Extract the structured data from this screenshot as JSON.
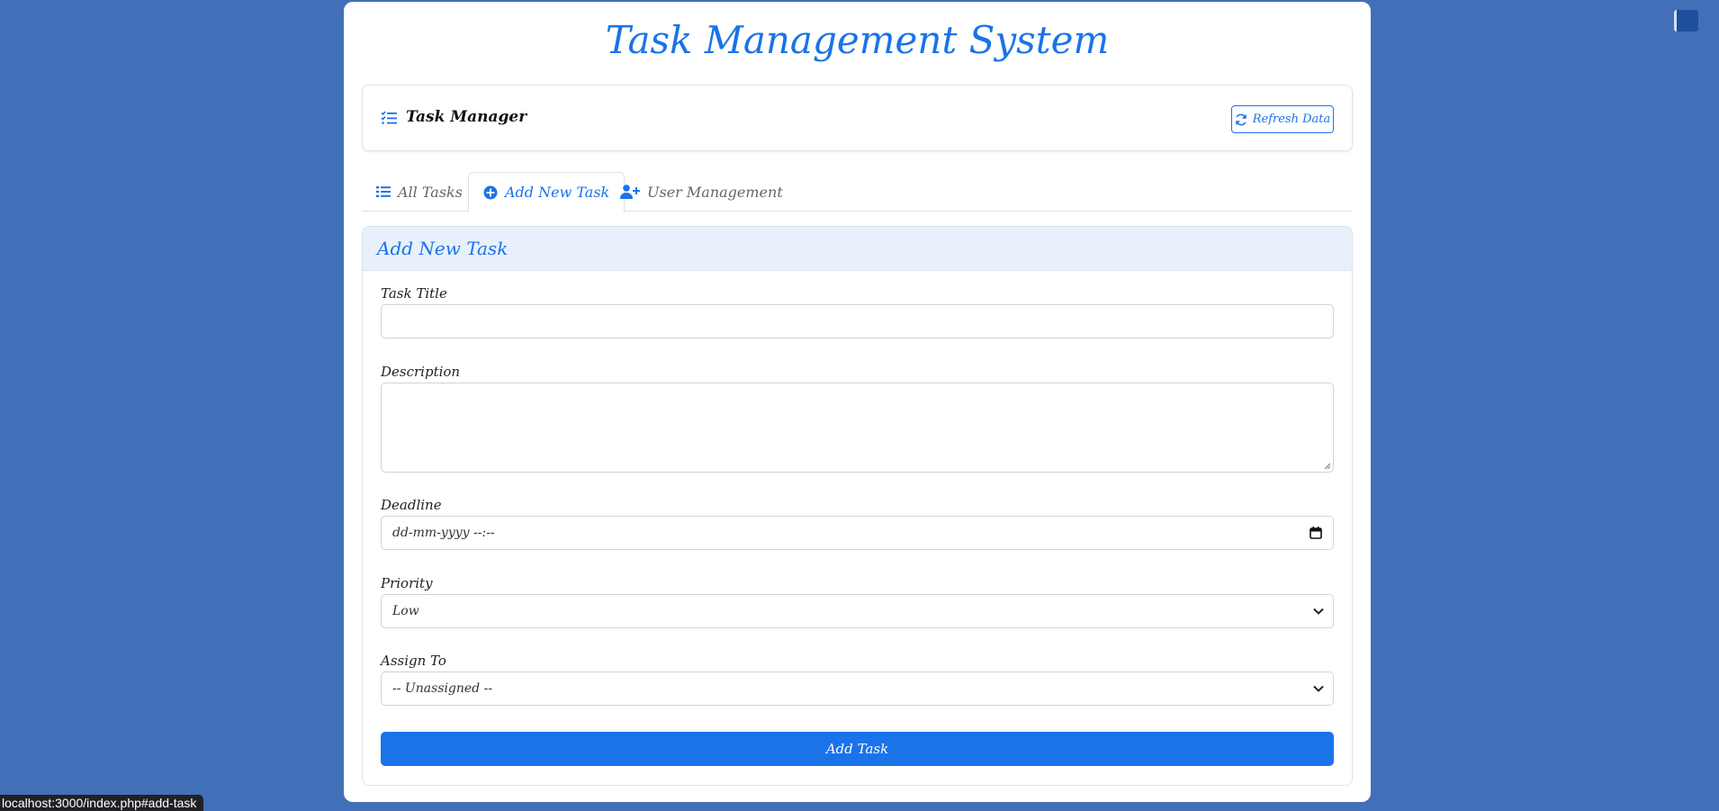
{
  "app": {
    "title": "Task Management System"
  },
  "navbar": {
    "brand": "Task Manager",
    "brand_icon": "task-list-icon",
    "refresh_label": "Refresh Data",
    "refresh_icon": "refresh-icon"
  },
  "tabs": [
    {
      "label": "All Tasks",
      "icon": "list-icon",
      "active": false
    },
    {
      "label": "Add New Task",
      "icon": "plus-circle-icon",
      "active": true
    },
    {
      "label": "User Management",
      "icon": "user-plus-icon",
      "active": false
    }
  ],
  "form": {
    "header": "Add New Task",
    "title_label": "Task Title",
    "title_value": "",
    "description_label": "Description",
    "description_value": "",
    "deadline_label": "Deadline",
    "deadline_placeholder": "dd-mm-yyyy --:--",
    "priority_label": "Priority",
    "priority_value": "Low",
    "assign_label": "Assign To",
    "assign_value": "-- Unassigned --",
    "submit_label": "Add Task"
  },
  "status_bar": {
    "url": "localhost:3000/index.php#add-task"
  },
  "colors": {
    "background": "#4270b8",
    "accent": "#1a73e8"
  }
}
